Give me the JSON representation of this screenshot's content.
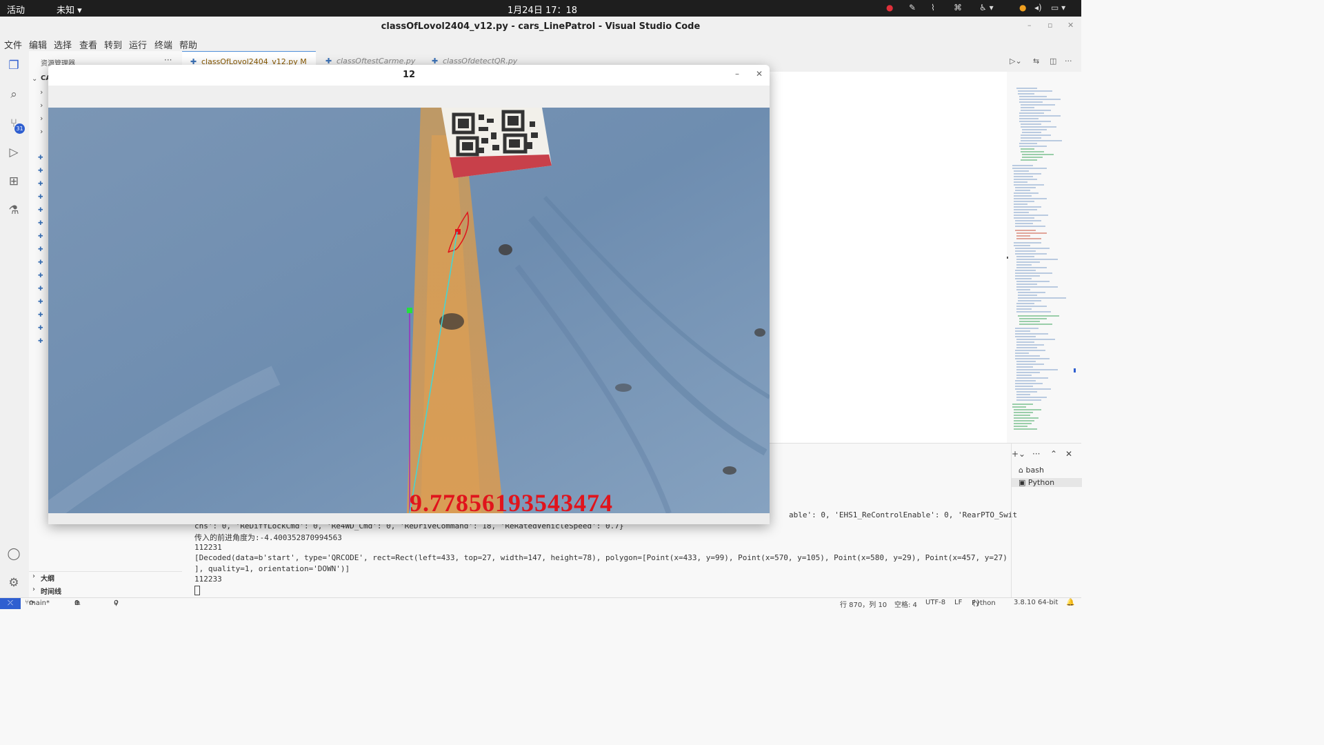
{
  "system": {
    "activities": "活动",
    "app_menu": "未知",
    "clock": "1月24日 17：18"
  },
  "window": {
    "title": "classOfLovol2404_v12.py - cars_LinePatrol - Visual Studio Code"
  },
  "menu": [
    "文件",
    "编辑",
    "选择",
    "查看",
    "转到",
    "运行",
    "终端",
    "帮助"
  ],
  "explorer": {
    "title": "资源管理器",
    "root_label": "CA",
    "outline": "大纲",
    "timeline": "时间线"
  },
  "scm_badge": "31",
  "tabs": [
    {
      "label": "classOfLovol2404_v12.py",
      "status": "M"
    },
    {
      "label": "classOftestCarme.py"
    },
    {
      "label": "classOfdetectQR.py"
    }
  ],
  "cv_window": {
    "title": "12",
    "overlay_value": "9.77856193543474"
  },
  "terminal": {
    "lines": [
      "cns': 0, 'ReDiffLockCmd': 0, 'Re4WD_Cmd': 0, 'ReDriveCommand': 18, 'ReRatedVehicleSpeed': 0.7}",
      "传入的前进角度为:-4.400352870994563",
      "112231",
      "[Decoded(data=b'start', type='QRCODE', rect=Rect(left=433, top=27, width=147, height=78), polygon=[Point(x=433, y=99), Point(x=570, y=105), Point(x=580, y=29), Point(x=457, y=27)",
      "], quality=1, orientation='DOWN')]",
      "112233"
    ],
    "right_fragment": "able': 0, 'EHS1_ReControlEnable': 0, 'RearPTO_Swit",
    "shells": [
      "bash",
      "Python"
    ]
  },
  "status": {
    "branch": "main*",
    "errors": "0",
    "warnings": "0",
    "ports": "0",
    "position": "行 870，列 10",
    "spaces": "空格: 4",
    "encoding": "UTF-8",
    "eol": "LF",
    "language": "Python",
    "interpreter": "3.8.10 64-bit"
  }
}
